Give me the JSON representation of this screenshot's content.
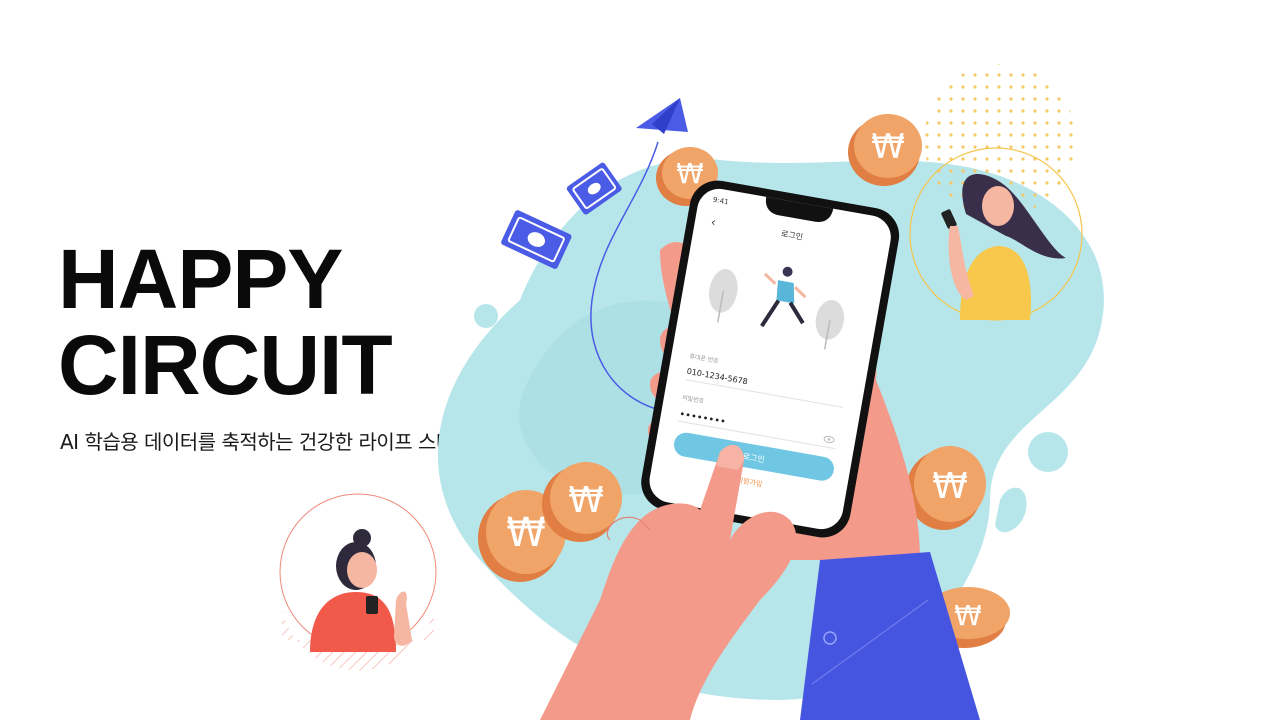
{
  "hero": {
    "title_line1": "HAPPY",
    "title_line2": "CIRCUIT",
    "subtitle": "AI 학습용 데이터를 축적하는 건강한 라이프 스타일 플랫폼"
  },
  "phone": {
    "status_time": "9:41",
    "back_icon": "chevron-left-icon",
    "screen_title": "로그인",
    "phone_label": "휴대폰 번호",
    "phone_value": "010-1234-5678",
    "password_label": "비밀번호",
    "password_value": "••••••••",
    "login_button": "로그인",
    "signup_link": "회원가입"
  },
  "icons": [
    "paper-plane-icon",
    "banknote-icon",
    "won-coin-icon",
    "eye-icon"
  ],
  "colors": {
    "blob": "#b7e6ea",
    "coin": "#f0a468",
    "coin_edge": "#e07e43",
    "money": "#4a5be6",
    "sleeve": "#4555e0",
    "skin": "#f49a8a",
    "login_button": "#6fc7e4"
  }
}
